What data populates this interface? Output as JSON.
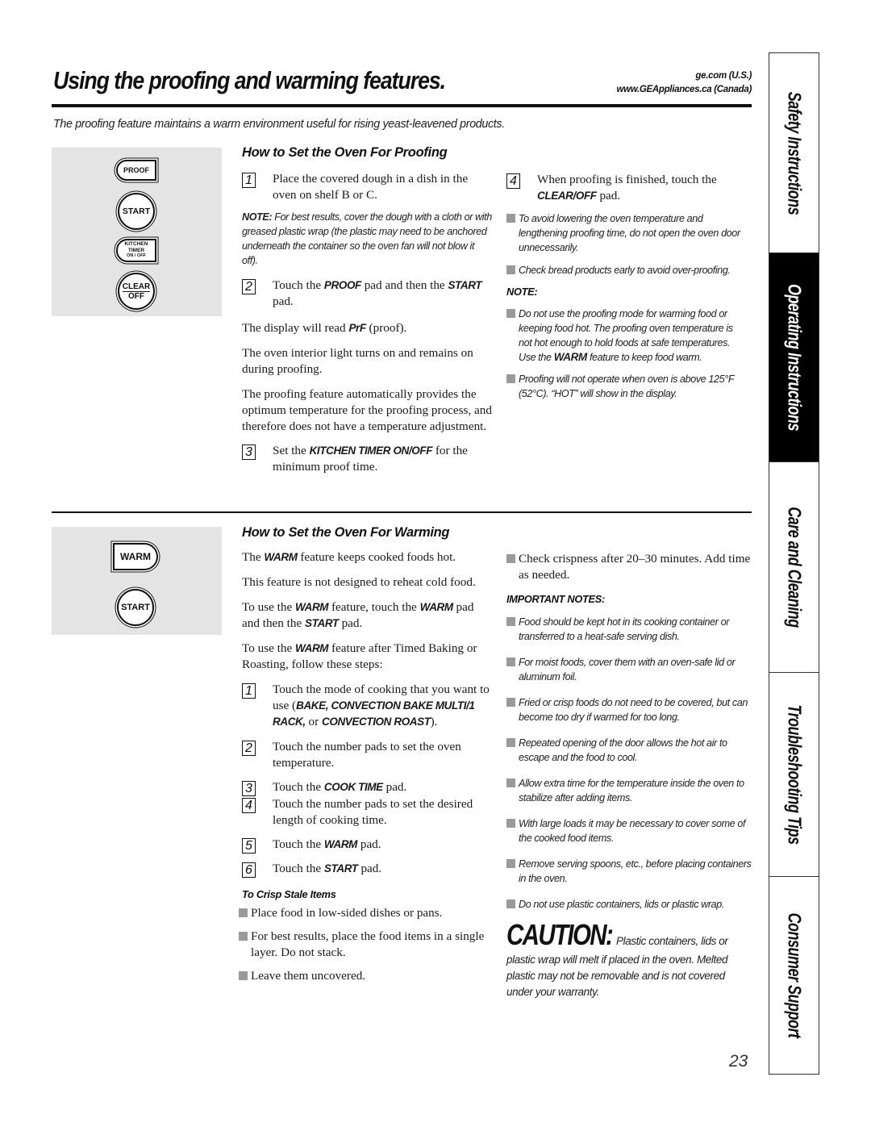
{
  "header": {
    "title": "Using the proofing and warming features.",
    "site_us": "ge.com (U.S.)",
    "site_canada": "www.GEAppliances.ca (Canada)",
    "intro": "The proofing feature maintains a warm environment useful for rising yeast-leavened products."
  },
  "proofing": {
    "pads": {
      "proof": "PROOF",
      "start": "START",
      "kitchen_timer_line1": "KITCHEN",
      "kitchen_timer_line2": "TIMER",
      "kitchen_timer_line3": "ON / OFF",
      "clear": "CLEAR",
      "off": "OFF"
    },
    "heading": "How to Set the Oven For Proofing",
    "step1": {
      "num": "1",
      "text": "Place the covered dough in a dish in the oven on shelf B or C."
    },
    "note1": {
      "label": "NOTE:",
      "text": " For best results, cover the dough with a cloth or with greased plastic wrap (the plastic may need to be anchored underneath the container so the oven fan will not blow it off)."
    },
    "step2": {
      "num": "2",
      "pre": "Touch the ",
      "b1": "PROOF",
      "mid": " pad and then the ",
      "b2": "START",
      "post": " pad."
    },
    "display": {
      "pre": "The display will read ",
      "b": "PrF",
      "post": " (proof)."
    },
    "light": "The oven interior light turns on and remains on during proofing.",
    "auto": "The proofing feature automatically provides the optimum temperature for the proofing process, and therefore does not have a temperature adjustment.",
    "step3": {
      "num": "3",
      "pre": "Set the ",
      "b": "KITCHEN TIMER ON/OFF",
      "post": " for the minimum proof time."
    },
    "step4": {
      "num": "4",
      "pre": "When proofing is finished, touch the ",
      "b": "CLEAR/OFF",
      "post": " pad."
    },
    "tips": [
      "To avoid lowering the oven temperature and lengthening proofing time, do not open the oven door unnecessarily.",
      "Check bread products early to avoid over-proofing."
    ],
    "note_heading": "NOTE:",
    "notes": {
      "n1_pre": "Do not use the proofing mode for warming food or keeping food hot. The proofing oven temperature is not hot enough to hold foods at safe temperatures. Use the ",
      "n1_b": "WARM",
      "n1_post": " feature to keep food warm.",
      "n2": "Proofing will not operate when oven is above 125°F (52°C). “HOT” will show in the display."
    }
  },
  "warming": {
    "pads": {
      "warm": "WARM",
      "start": "START"
    },
    "heading": "How to Set the Oven For Warming",
    "p1": {
      "pre": "The ",
      "b": "WARM",
      "post": " feature keeps cooked foods hot."
    },
    "p2": "This feature is not designed to reheat cold food.",
    "p3": {
      "pre": "To use the ",
      "b1": "WARM",
      "mid": " feature, touch the ",
      "b2": "WARM",
      "mid2": " pad and then the ",
      "b3": "START",
      "post": " pad."
    },
    "p4": {
      "pre": "To use the ",
      "b": "WARM",
      "post": " feature after Timed Baking or Roasting, follow these steps:"
    },
    "steps": [
      {
        "num": "1",
        "pre": "Touch the mode of cooking that you want to use (",
        "b1": "BAKE, CONVECTION BAKE MULTI/1 RACK,",
        "mid": " or ",
        "b2": "CONVECTION ROAST",
        "post": ")."
      },
      {
        "num": "2",
        "text": "Touch the number pads to set the oven temperature."
      },
      {
        "num": "3",
        "pre": "Touch the ",
        "b": "COOK TIME",
        "post": " pad."
      },
      {
        "num": "4",
        "text": "Touch the number pads to set the desired length of cooking time."
      },
      {
        "num": "5",
        "pre": "Touch the ",
        "b": "WARM",
        "post": " pad."
      },
      {
        "num": "6",
        "pre": "Touch the ",
        "b": "START",
        "post": " pad."
      }
    ],
    "crisp_heading": "To Crisp Stale Items",
    "crisp": [
      "Place food in low-sided dishes or pans.",
      "For best results, place the food items in a single layer. Do not stack.",
      "Leave them uncovered.",
      "Check crispness after 20–30 minutes. Add time as needed."
    ],
    "important_heading": "IMPORTANT NOTES:",
    "important": [
      "Food should be kept hot in its cooking container or transferred to a heat-safe serving dish.",
      "For moist foods, cover them with an oven-safe lid or aluminum foil.",
      "Fried or crisp foods do not need to be covered, but can become too dry if warmed for too long.",
      "Repeated opening of the door allows the hot air to escape and the food to cool.",
      "Allow extra time for the temperature inside the oven to stabilize after adding items.",
      "With large loads it may be necessary to cover some of the cooked food items.",
      "Remove serving spoons, etc., before placing containers in the oven.",
      "Do not use plastic containers, lids or plastic wrap."
    ],
    "caution_word": "CAUTION:",
    "caution_text": "Plastic containers, lids or plastic wrap will melt if placed in the oven. Melted plastic may not be removable and is not covered under your warranty."
  },
  "page_number": "23",
  "side_tabs": [
    {
      "label": "Safety Instructions",
      "active": false
    },
    {
      "label": "Operating Instructions",
      "active": true
    },
    {
      "label": "Care and Cleaning",
      "active": false
    },
    {
      "label": "Troubleshooting Tips",
      "active": false
    },
    {
      "label": "Consumer Support",
      "active": false
    }
  ],
  "colors": {
    "tab_active_bg": "#000000",
    "panel_bg": "#e4e4e4",
    "bullet": "#9a9a9a"
  }
}
